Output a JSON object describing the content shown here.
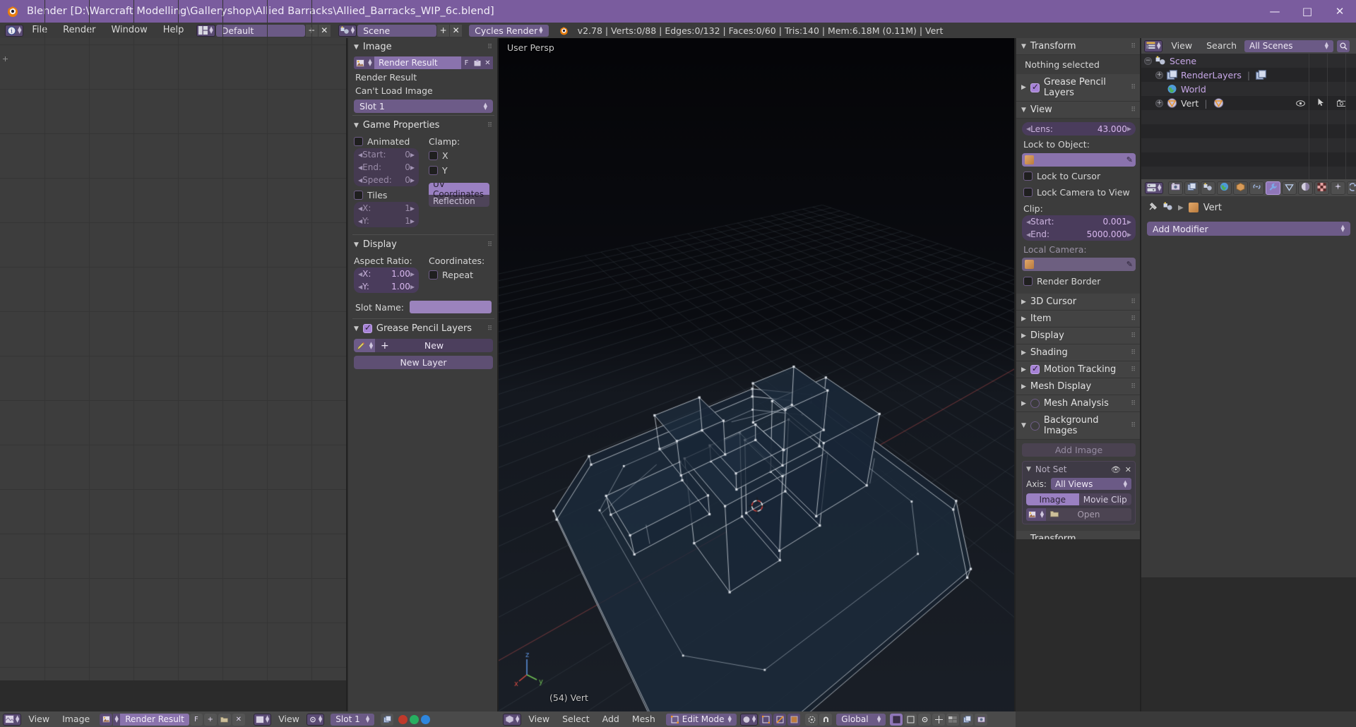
{
  "window": {
    "title": "Blender [D:\\Warcraft Modelling\\Galleryshop\\Allied Barracks\\Allied_Barracks_WIP_6c.blend]",
    "minimize": "—",
    "maximize": "□",
    "close": "✕"
  },
  "topbar": {
    "menus": [
      "File",
      "Render",
      "Window",
      "Help"
    ],
    "screen_layout": "Default",
    "scene": "Scene",
    "engine": "Cycles Render",
    "plus": "+",
    "x": "✕",
    "stats": "v2.78 | Verts:0/88 | Edges:0/132 | Faces:0/60 | Tris:140 | Mem:6.18M (0.11M) | Vert"
  },
  "image_props": {
    "image_section": {
      "title": "Image",
      "datablock_name": "Render Result",
      "fake_user": "F",
      "pack_icon": "pack-icon",
      "close_icon": "✕",
      "line1": "Render Result",
      "line2": "Can't Load Image",
      "slot": "Slot 1"
    },
    "game_properties": {
      "title": "Game Properties",
      "animated": "Animated",
      "animated_checked": false,
      "start_label": "Start:",
      "start_value": "0",
      "end_label": "End:",
      "end_value": "0",
      "speed_label": "Speed:",
      "speed_value": "0",
      "tiles": "Tiles",
      "tiles_checked": false,
      "tx_label": "X:",
      "tx_value": "1",
      "ty_label": "Y:",
      "ty_value": "1",
      "clamp_label": "Clamp:",
      "clamp_x": "X",
      "clamp_x_checked": false,
      "clamp_y": "Y",
      "clamp_y_checked": false,
      "mapping_selected": "UV Coordinates",
      "mapping_other": "Reflection"
    },
    "display": {
      "title": "Display",
      "aspect_label": "Aspect Ratio:",
      "ax_label": "X:",
      "ax_value": "1.00",
      "ay_label": "Y:",
      "ay_value": "1.00",
      "coordinates_label": "Coordinates:",
      "repeat": "Repeat",
      "repeat_checked": false,
      "slot_name_label": "Slot Name:",
      "slot_name_value": ""
    },
    "grease_pencil": {
      "title": "Grease Pencil Layers",
      "checked": true,
      "new_button": "New",
      "plus": "+",
      "new_layer_button": "New Layer"
    }
  },
  "viewport": {
    "view_name": "User Persp",
    "object_info": "(54) Vert",
    "axis_labels": {
      "x": "x",
      "y": "y",
      "z": "z"
    }
  },
  "right_props": {
    "transform": {
      "title": "Transform",
      "content": "Nothing selected"
    },
    "grease_pencil": {
      "title": "Grease Pencil Layers",
      "checked": true
    },
    "view": {
      "title": "View",
      "lens_label": "Lens:",
      "lens_value": "43.000",
      "lock_object_label": "Lock to Object:",
      "lock_object_value": "",
      "lock_cursor": "Lock to Cursor",
      "lock_cursor_checked": false,
      "lock_camera": "Lock Camera to View",
      "lock_camera_checked": false,
      "clip_label": "Clip:",
      "clip_start_label": "Start:",
      "clip_start_value": "0.001",
      "clip_end_label": "End:",
      "clip_end_value": "5000.000",
      "local_camera_label": "Local Camera:",
      "local_camera_value": "",
      "render_border": "Render Border",
      "render_border_checked": false
    },
    "collapsed": [
      {
        "title": "3D Cursor",
        "has_check": false,
        "checked": false
      },
      {
        "title": "Item",
        "has_check": false,
        "checked": false
      },
      {
        "title": "Display",
        "has_check": false,
        "checked": false
      },
      {
        "title": "Shading",
        "has_check": false,
        "checked": false
      },
      {
        "title": "Motion Tracking",
        "has_check": true,
        "checked": true
      },
      {
        "title": "Mesh Display",
        "has_check": false,
        "checked": false
      },
      {
        "title": "Mesh Analysis",
        "has_check": true,
        "checked": false
      }
    ],
    "background_images": {
      "title": "Background Images",
      "checked": false,
      "add_image": "Add Image",
      "entry_name": "Not Set",
      "axis_label": "Axis:",
      "axis_value": "All Views",
      "tab_image": "Image",
      "tab_movie": "Movie Clip",
      "open_button": "Open",
      "eye_icon": "👁",
      "close_icon": "✕"
    },
    "transform_orientations": {
      "title": "Transform Orientations"
    }
  },
  "outliner": {
    "header": {
      "view": "View",
      "search": "Search",
      "display_mode": "All Scenes"
    },
    "rows": [
      {
        "name": "Scene",
        "indent": 0,
        "color": "#c8a8e8",
        "icon": "scene-icon",
        "expand": "−"
      },
      {
        "name": "RenderLayers",
        "indent": 1,
        "color": "#c8a8e8",
        "icon": "renderlayers-icon",
        "expand": "+"
      },
      {
        "name": "World",
        "indent": 1,
        "color": "#c8a8e8",
        "icon": "world-icon",
        "expand": ""
      },
      {
        "name": "Vert",
        "indent": 1,
        "color": "#dcdcdc",
        "icon": "mesh-icon",
        "expand": "+"
      }
    ]
  },
  "properties_editor": {
    "tabs": [
      "render-icon",
      "renderlayers-icon",
      "scene-icon",
      "world-icon",
      "object-icon",
      "constraint-icon",
      "modifier-icon",
      "data-icon",
      "material-icon",
      "texture-icon",
      "particles-icon",
      "physics-icon"
    ],
    "active_tab_index": 6,
    "breadcrumb_scene": "Scene",
    "breadcrumb_object": "Vert",
    "add_modifier": "Add Modifier"
  },
  "footer_left": {
    "menus": [
      "View",
      "Image"
    ],
    "datablock": "Render Result",
    "fake_user": "F",
    "plus": "+",
    "x": "✕",
    "view_menu": "View",
    "slot": "Slot 1",
    "color_r": "#c0392b",
    "color_g": "#27ae60",
    "color_b": "#2e86de"
  },
  "footer_mid": {
    "menus": [
      "View",
      "Select",
      "Add",
      "Mesh"
    ],
    "mode": "Edit Mode",
    "orientation": "Global"
  }
}
